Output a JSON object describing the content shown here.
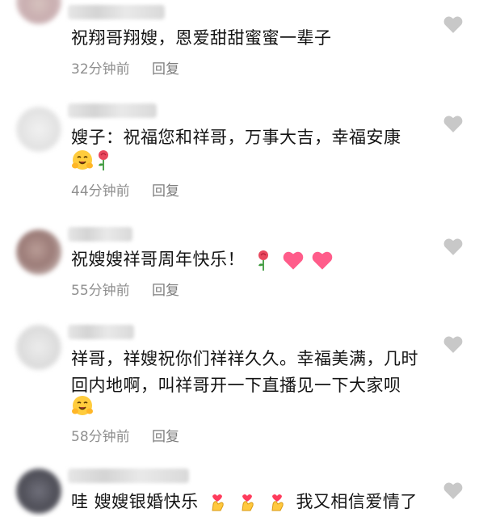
{
  "comments": [
    {
      "text_lines": [
        "祝翔哥翔嫂，恩爱甜甜蜜蜜一辈子"
      ],
      "time": "32分钟前",
      "reply": "回复"
    },
    {
      "text_lines": [
        "嫂子：祝福您和祥哥，万事大吉，幸福安康"
      ],
      "emojis": [
        "hug-emoji",
        "rose-emoji"
      ],
      "time": "44分钟前",
      "reply": "回复"
    },
    {
      "text_lines": [
        "祝嫂嫂祥哥周年快乐！"
      ],
      "inline_emojis": [
        "rose-emoji",
        "heart-emoji",
        "heart-emoji"
      ],
      "time": "55分钟前",
      "reply": "回复"
    },
    {
      "text_lines": [
        "祥哥，祥嫂祝你们祥祥久久。幸福美满，几时",
        "回内地啊，叫祥哥开一下直播见一下大家呗"
      ],
      "emojis": [
        "hug-emoji"
      ],
      "time": "58分钟前",
      "reply": "回复"
    },
    {
      "text_lines": [
        "哇 嫂嫂银婚快乐"
      ],
      "text_tail": "我又相信爱情了",
      "inline_emojis": [
        "finger-heart-emoji",
        "finger-heart-emoji",
        "finger-heart-emoji"
      ]
    }
  ],
  "colors": {
    "meta_gray": "#8f8f8f",
    "like_gray": "#c8c8c8",
    "heart_pink": "#ff5c8a",
    "rose_red": "#e8485e"
  }
}
